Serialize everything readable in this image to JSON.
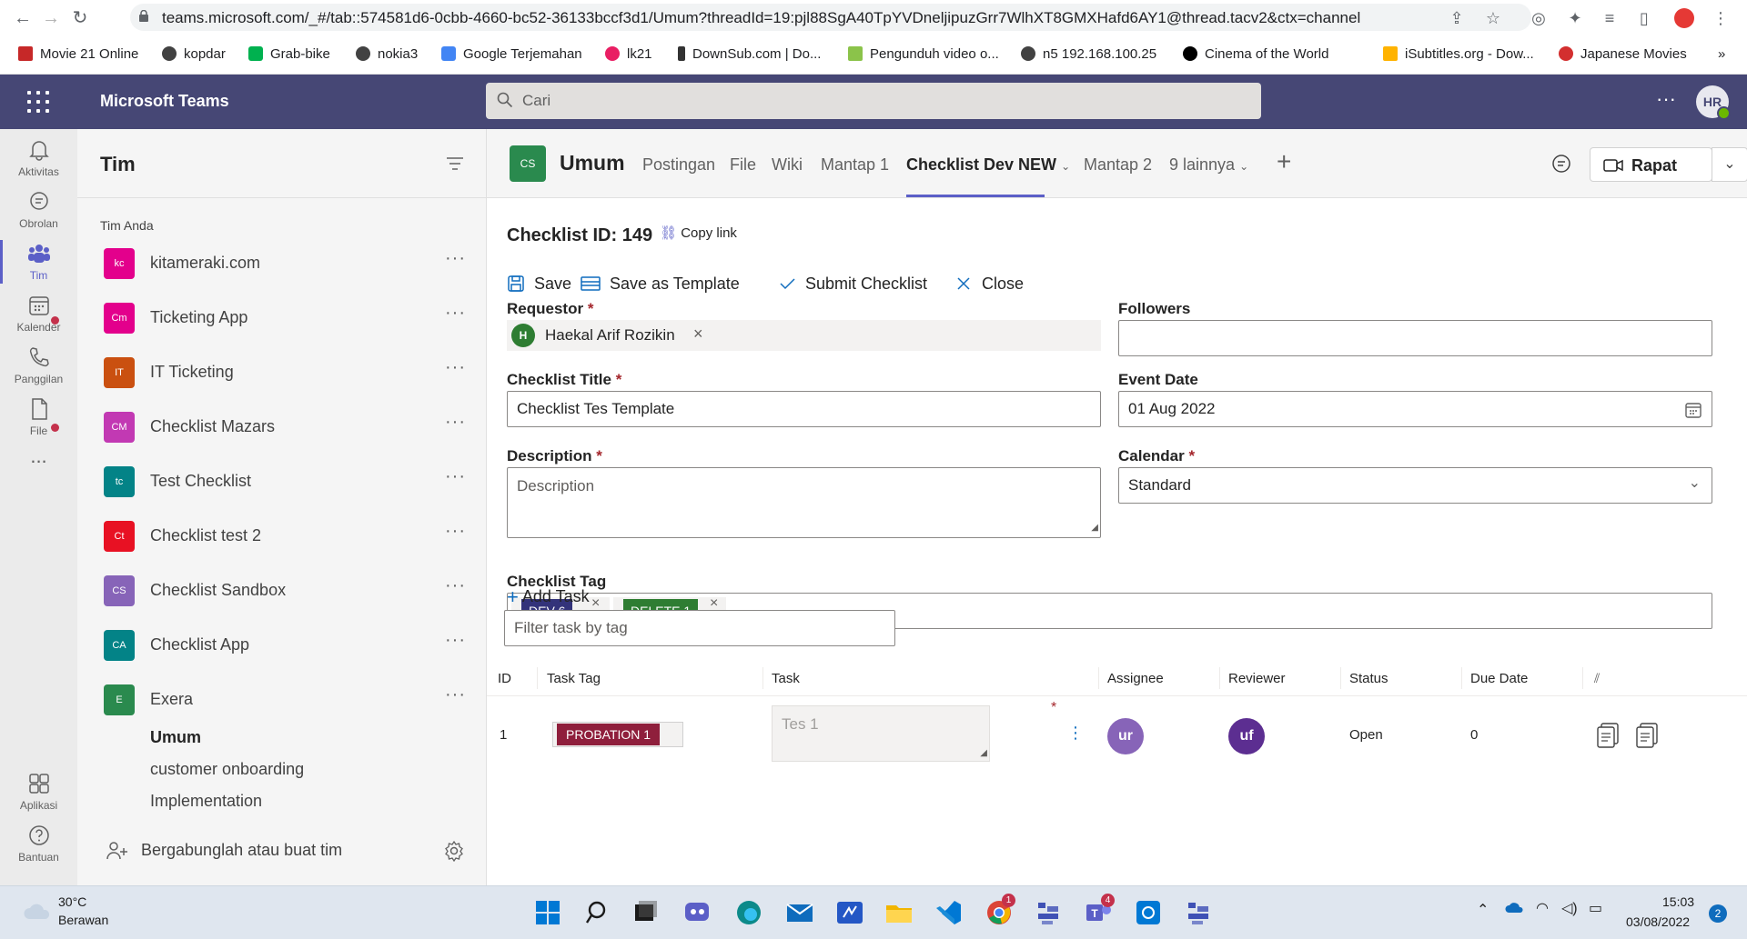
{
  "browser": {
    "url": "teams.microsoft.com/_#/tab::574581d6-0cbb-4660-bc52-36133bccf3d1/Umum?threadId=19:pjl88SgA40TpYVDneljipuzGrr7WlhXT8GMXHafd6AY1@thread.tacv2&ctx=channel",
    "bookmarks": [
      "Movie 21 Online",
      "kopdar",
      "Grab-bike",
      "nokia3",
      "Google Terjemahan",
      "lk21",
      "DownSub.com | Do...",
      "Pengunduh video o...",
      "n5 192.168.100.25",
      "Cinema of the World",
      "iSubtitles.org - Dow...",
      "Japanese Movies"
    ],
    "bookmarks_more": "»"
  },
  "teams_header": {
    "app_title": "Microsoft Teams",
    "search_placeholder": "Cari",
    "avatar_initials": "HR",
    "more": "···"
  },
  "rail": {
    "items": [
      {
        "label": "Aktivitas",
        "icon": "bell-icon"
      },
      {
        "label": "Obrolan",
        "icon": "chat-icon"
      },
      {
        "label": "Tim",
        "icon": "teams-icon"
      },
      {
        "label": "Kalender",
        "icon": "calendar-icon"
      },
      {
        "label": "Panggilan",
        "icon": "phone-icon"
      },
      {
        "label": "File",
        "icon": "file-icon"
      },
      {
        "label": "...",
        "icon": "more-icon"
      },
      {
        "label": "Aplikasi",
        "icon": "apps-icon"
      },
      {
        "label": "Bantuan",
        "icon": "help-icon"
      }
    ]
  },
  "teams_panel": {
    "title": "Tim",
    "section": "Tim Anda",
    "teams": [
      {
        "initials": "kc",
        "name": "kitameraki.com",
        "color": "#e3008c"
      },
      {
        "initials": "Cm",
        "name": "Ticketing App",
        "color": "#e3008c"
      },
      {
        "initials": "IT",
        "name": "IT Ticketing",
        "color": "#ca5010"
      },
      {
        "initials": "CM",
        "name": "Checklist Mazars",
        "color": "#c239b3"
      },
      {
        "initials": "tc",
        "name": "Test Checklist",
        "color": "#038387"
      },
      {
        "initials": "Ct",
        "name": "Checklist test 2",
        "color": "#e81123"
      },
      {
        "initials": "CS",
        "name": "Checklist Sandbox",
        "color": "#8764b8"
      },
      {
        "initials": "CA",
        "name": "Checklist App",
        "color": "#038387"
      },
      {
        "initials": "E",
        "name": "Exera",
        "color": "#2a8a4e"
      }
    ],
    "channels": [
      "Umum",
      "customer onboarding",
      "Implementation"
    ],
    "join_label": "Bergabunglah atau buat tim"
  },
  "channel_header": {
    "tile": "CS",
    "name": "Umum",
    "tabs": [
      "Postingan",
      "File",
      "Wiki",
      "Mantap 1",
      "Checklist Dev NEW",
      "Mantap 2",
      "9 lainnya"
    ],
    "meet_label": "Rapat"
  },
  "form": {
    "checklist_id": "Checklist ID: 149",
    "copy_link": "Copy link",
    "toolbar": {
      "save": "Save",
      "save_template": "Save as Template",
      "submit": "Submit Checklist",
      "close": "Close"
    },
    "requestor_label": "Requestor",
    "requestor_initial": "H",
    "requestor_name": "Haekal Arif Rozikin",
    "followers_label": "Followers",
    "title_label": "Checklist Title",
    "title_value": "Checklist Tes Template",
    "event_date_label": "Event Date",
    "event_date_value": "01 Aug 2022",
    "description_label": "Description",
    "description_placeholder": "Description",
    "calendar_label": "Calendar",
    "calendar_value": "Standard",
    "tag_label": "Checklist Tag",
    "tags": [
      {
        "name": "DEV 6",
        "color": "#33337a"
      },
      {
        "name": "DELETE 1",
        "color": "#2e7d32"
      }
    ],
    "add_task": "Add Task",
    "filter_placeholder": "Filter task by tag",
    "required_mark": "*"
  },
  "task_table": {
    "headers": [
      "ID",
      "Task Tag",
      "Task",
      "Assignee",
      "Reviewer",
      "Status",
      "Due Date"
    ],
    "rows": [
      {
        "id": "1",
        "tag": "PROBATION 1",
        "tag_color": "#8f1f3c",
        "task": "Tes 1",
        "assignee": "ur",
        "assignee_color": "#8764b8",
        "reviewer": "uf",
        "reviewer_color": "#5c2e91",
        "status": "Open",
        "due": "0"
      }
    ]
  },
  "taskbar": {
    "weather_temp": "30°C",
    "weather_desc": "Berawan",
    "time": "15:03",
    "date": "03/08/2022",
    "notification_count": "2",
    "chrome_badge": "1",
    "teams_badge": "4"
  }
}
